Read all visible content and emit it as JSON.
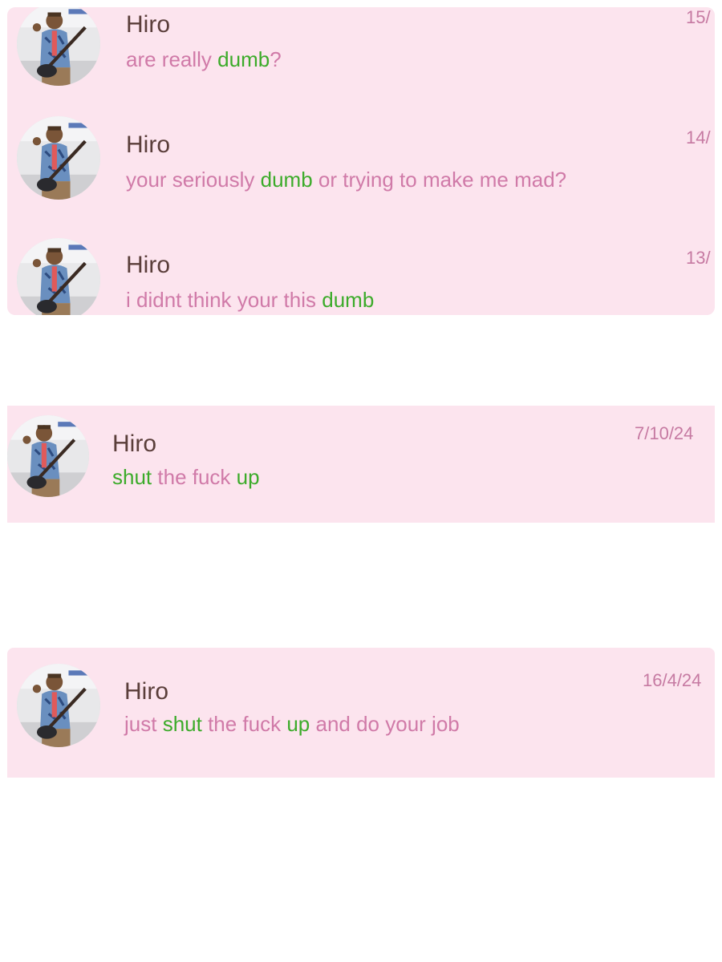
{
  "colors": {
    "card_background": "#fce4ee",
    "name_text": "#5a3e3a",
    "message_text": "#d07aa8",
    "highlight_text": "#3cab2a",
    "date_text": "#c67aa2",
    "page_background": "#ffffff"
  },
  "avatar_icon": "profile-photo-person-with-guitar",
  "messages": [
    {
      "sender": "Hiro",
      "date": "15/",
      "parts": [
        {
          "text": "are really ",
          "highlight": false
        },
        {
          "text": "dumb",
          "highlight": true
        },
        {
          "text": "?",
          "highlight": false
        }
      ]
    },
    {
      "sender": "Hiro",
      "date": "14/",
      "parts": [
        {
          "text": "your seriously ",
          "highlight": false
        },
        {
          "text": "dumb",
          "highlight": true
        },
        {
          "text": " or trying to make me mad?",
          "highlight": false
        }
      ]
    },
    {
      "sender": "Hiro",
      "date": "13/",
      "parts": [
        {
          "text": "i didnt think your this ",
          "highlight": false
        },
        {
          "text": "dumb",
          "highlight": true
        }
      ]
    },
    {
      "sender": "Hiro",
      "date": "7/10/24",
      "parts": [
        {
          "text": "shut",
          "highlight": true
        },
        {
          "text": " the fuck ",
          "highlight": false
        },
        {
          "text": "up",
          "highlight": true
        }
      ]
    },
    {
      "sender": "Hiro",
      "date": "16/4/24",
      "parts": [
        {
          "text": "just ",
          "highlight": false
        },
        {
          "text": "shut",
          "highlight": true
        },
        {
          "text": " the fuck ",
          "highlight": false
        },
        {
          "text": "up",
          "highlight": true
        },
        {
          "text": " and do your job",
          "highlight": false
        }
      ]
    }
  ]
}
